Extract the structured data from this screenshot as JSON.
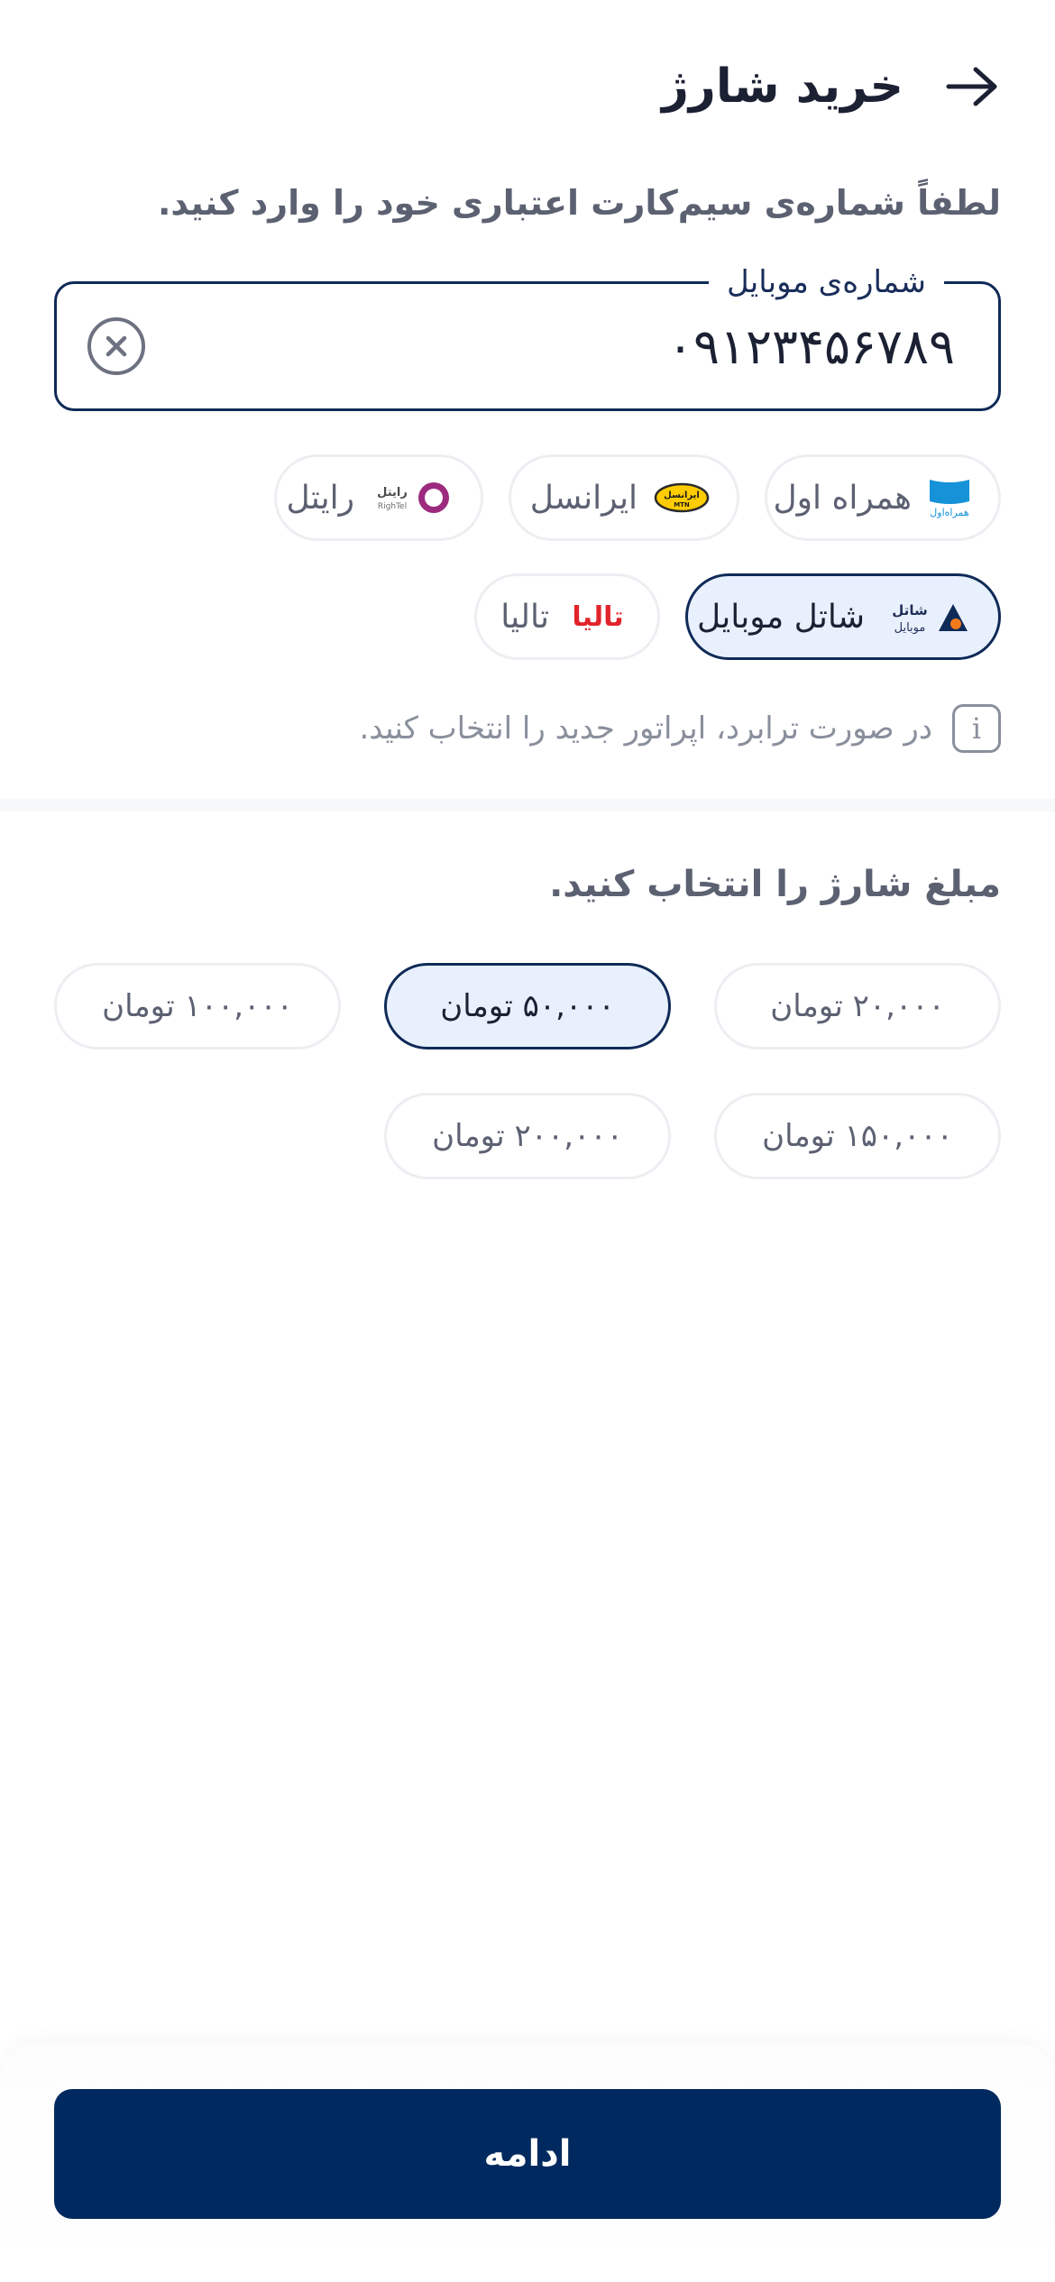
{
  "header": {
    "title": "خرید شارژ"
  },
  "instruction": "لطفاً شماره‌ی سیم‌کارت اعتباری خود را وارد کنید.",
  "phone_field": {
    "label": "شماره‌ی موبایل",
    "value": "۰۹۱۲۳۴۵۶۷۸۹"
  },
  "operators": [
    {
      "id": "hamrah-aval",
      "label": "همراه اول",
      "logo_text": "همراه‌اول",
      "selected": false
    },
    {
      "id": "irancell",
      "label": "ایرانسل",
      "logo_text": "ایرانسل",
      "logo_sub": "MTN",
      "selected": false
    },
    {
      "id": "rightel",
      "label": "رایتل",
      "logo_text": "رایتل",
      "logo_sub": "RighTel",
      "selected": false
    },
    {
      "id": "shatel",
      "label": "شاتل موبایل",
      "logo_text": "شاتل",
      "logo_sub": "موبایل",
      "selected": true
    },
    {
      "id": "taliya",
      "label": "تالیا",
      "logo_text": "تالیا",
      "selected": false
    }
  ],
  "hint": "در صورت ترابرد، اپراتور جدید را انتخاب کنید.",
  "amount_title": "مبلغ شارژ را انتخاب کنید.",
  "amounts": [
    {
      "label": "۲۰,۰۰۰ تومان",
      "selected": false
    },
    {
      "label": "۵۰,۰۰۰ تومان",
      "selected": true
    },
    {
      "label": "۱۰۰,۰۰۰ تومان",
      "selected": false
    },
    {
      "label": "۱۵۰,۰۰۰ تومان",
      "selected": false
    },
    {
      "label": "۲۰۰,۰۰۰ تومان",
      "selected": false
    }
  ],
  "continue_label": "ادامه",
  "colors": {
    "primary": "#002a5f",
    "selected_bg": "#e8f0fd",
    "hamrah_blue": "#1592d8",
    "irancell_yellow": "#ffcc00",
    "rightel_purple": "#9c2a7e",
    "taliya_red": "#e1242b"
  }
}
